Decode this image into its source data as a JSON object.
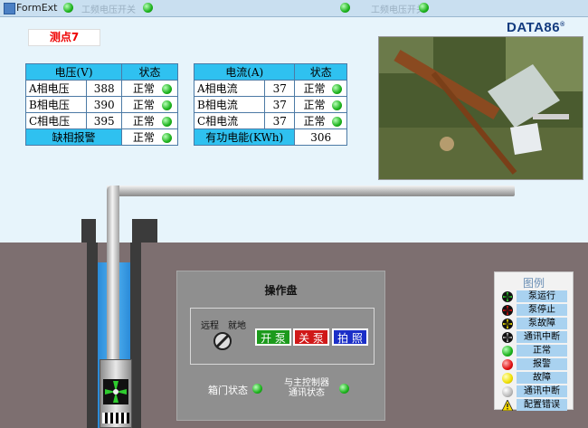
{
  "window": {
    "title": "FormExt",
    "ghost_left": "工频电压开关",
    "ghost_right": "工频电压开关"
  },
  "logo": "DATA86",
  "logo_mark": "®",
  "point_label": "测点7",
  "voltage_table": {
    "headers": [
      "电压(V)",
      "状态"
    ],
    "rows": [
      {
        "label": "A相电压",
        "value": "388",
        "status": "正常"
      },
      {
        "label": "B相电压",
        "value": "390",
        "status": "正常"
      },
      {
        "label": "C相电压",
        "value": "395",
        "status": "正常"
      }
    ],
    "footer": {
      "label": "缺相报警",
      "status": "正常"
    }
  },
  "current_table": {
    "headers": [
      "电流(A)",
      "状态"
    ],
    "rows": [
      {
        "label": "A相电流",
        "value": "37",
        "status": "正常"
      },
      {
        "label": "B相电流",
        "value": "37",
        "status": "正常"
      },
      {
        "label": "C相电流",
        "value": "37",
        "status": "正常"
      }
    ],
    "footer": {
      "label": "有功电能(KWh)",
      "value": "306"
    }
  },
  "panel": {
    "title": "操作盘",
    "switch_left": "远程",
    "switch_right": "就地",
    "buttons": {
      "start": "开 泵",
      "stop": "关 泵",
      "photo": "拍 照"
    },
    "door_status": "箱门状态",
    "comm_status_line1": "与主控制器",
    "comm_status_line2": "通讯状态"
  },
  "legend": {
    "title": "图例",
    "items": [
      {
        "label": "泵运行",
        "icon": "fan-green-icon"
      },
      {
        "label": "泵停止",
        "icon": "fan-red-icon"
      },
      {
        "label": "泵故障",
        "icon": "fan-yellow-icon"
      },
      {
        "label": "通讯中断",
        "icon": "fan-gray-icon"
      },
      {
        "label": "正常",
        "icon": "green-lamp-icon"
      },
      {
        "label": "报警",
        "icon": "red-lamp-icon"
      },
      {
        "label": "故障",
        "icon": "yellow-lamp-icon"
      },
      {
        "label": "通讯中断",
        "icon": "gray-lamp-icon"
      },
      {
        "label": "配置错误",
        "icon": "warning-icon"
      }
    ]
  },
  "colors": {
    "normal": "#1db21d",
    "alarm": "#e01010",
    "fault": "#f0e000",
    "offline": "#bbbbbb",
    "header": "#2fc1f0",
    "start_button": "#1c9a1c",
    "stop_button": "#d01818",
    "photo_button": "#1b2fc8"
  }
}
